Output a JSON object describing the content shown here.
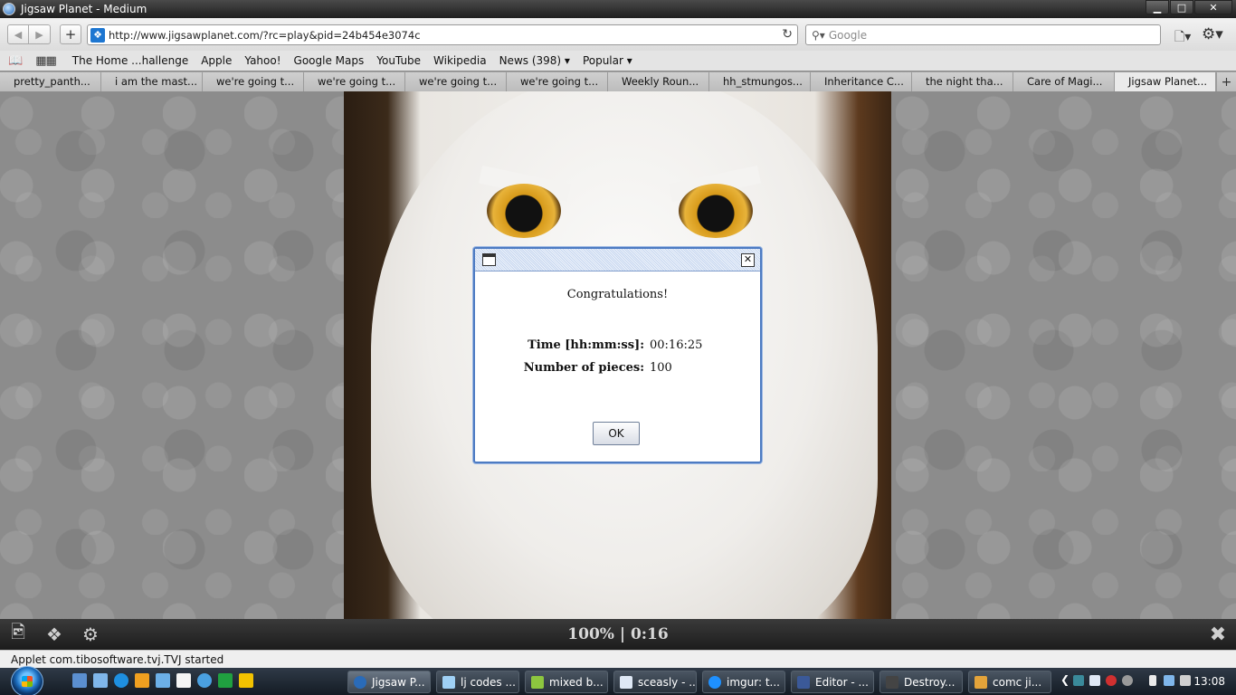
{
  "window": {
    "title": "Jigsaw Planet - Medium",
    "buttons": [
      "▁",
      "□",
      "✕"
    ]
  },
  "nav": {
    "url": "http://www.jigsawplanet.com/?rc=play&pid=24b454e3074c",
    "search_placeholder": "Google"
  },
  "bookmarks": [
    "The Home ...hallenge",
    "Apple",
    "Yahoo!",
    "Google Maps",
    "YouTube",
    "Wikipedia",
    "News (398) ▾",
    "Popular ▾"
  ],
  "tabs": [
    "pretty_panth...",
    "i am the mast...",
    "we're going t...",
    "we're going t...",
    "we're going t...",
    "we're going t...",
    "Weekly Roun...",
    "hh_stmungos...",
    "Inheritance C...",
    "the night tha...",
    "Care of Magi...",
    "Jigsaw Planet..."
  ],
  "dialog": {
    "congrats": "Congratulations!",
    "time_label": "Time [hh:mm:ss]:",
    "time_value": "00:16:25",
    "pieces_label": "Number of pieces:",
    "pieces_value": "100",
    "ok_label": "OK"
  },
  "gamebar": {
    "status": "100% | 0:16"
  },
  "statusbar": {
    "text": "Applet com.tibosoftware.tvj.TVJ started"
  },
  "taskbar": {
    "items": [
      {
        "label": "Jigsaw P...",
        "color": "#2a6bb8"
      },
      {
        "label": "lj codes ...",
        "color": "#9fd0f5"
      },
      {
        "label": "mixed b...",
        "color": "#8dc63f"
      },
      {
        "label": "sceasly - ...",
        "color": "#dfe8f5"
      },
      {
        "label": "imgur: t...",
        "color": "#1e90ff"
      },
      {
        "label": "Editor - ...",
        "color": "#3b5998"
      },
      {
        "label": "Destroy...",
        "color": "#444444"
      },
      {
        "label": "comc ji...",
        "color": "#e3a33a"
      }
    ],
    "clock": "13:08"
  }
}
